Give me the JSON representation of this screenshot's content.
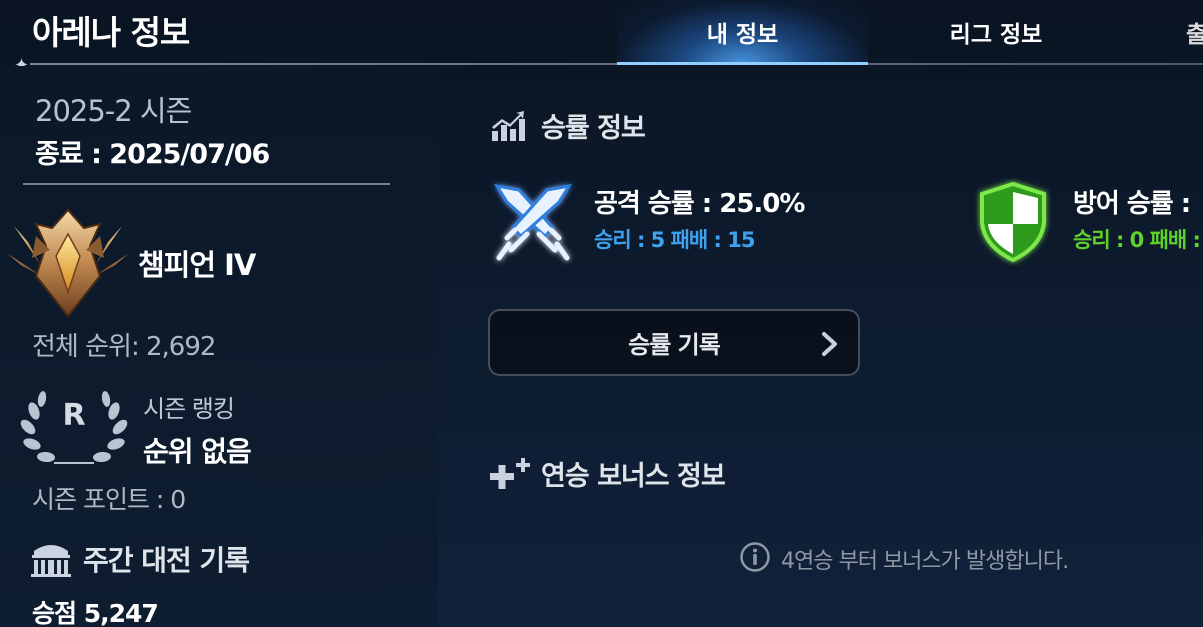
{
  "header": {
    "title": "아레나 정보",
    "tabs": [
      {
        "label": "내 정보",
        "active": true
      },
      {
        "label": "리그 정보",
        "active": false
      },
      {
        "label": "출",
        "active": false
      }
    ]
  },
  "season": {
    "name": "2025-2 시즌",
    "end": "종료 : 2025/07/06"
  },
  "tier": {
    "name": "챔피언 IV",
    "total_rank": "전체 순위: 2,692"
  },
  "season_ranking": {
    "label": "시즌 랭킹",
    "value": "순위 없음",
    "emblem_letter": "R",
    "points": "시즌 포인트 : 0"
  },
  "weekly": {
    "title": "주간 대전 기록",
    "score": "승점 5,247"
  },
  "winrate": {
    "title": "승률 정보",
    "attack": {
      "rate": "공격 승률 : 25.0%",
      "record": "승리 : 5 패배 : 15",
      "color": "#3fa2ef"
    },
    "defense": {
      "rate": "방어 승률 :",
      "record": "승리 : 0 패배 :",
      "color": "#5ed12c"
    },
    "history_button": "승률 기록"
  },
  "bonus": {
    "title": "연승 보너스 정보",
    "note": "4연승 부터 보너스가 발생합니다."
  },
  "icons": [
    "sparkle-icon",
    "champion-emblem-icon",
    "laurel-icon",
    "colosseum-icon",
    "chart-icon",
    "crossed-swords-icon",
    "shield-icon",
    "chevron-right-icon",
    "plus-bonus-icon",
    "info-icon"
  ]
}
